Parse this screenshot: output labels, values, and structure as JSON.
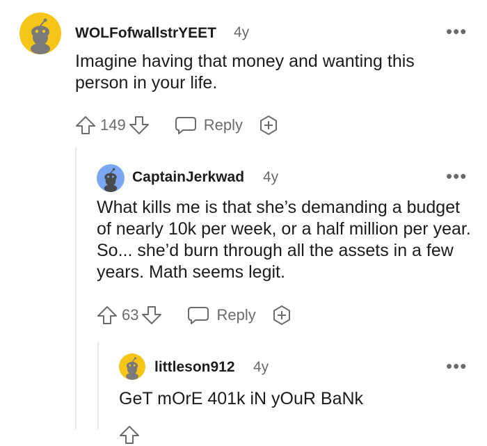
{
  "comments": [
    {
      "username": "WOLFofwallstrYEET",
      "age": "4y",
      "avatar_color": "#f5c518",
      "body": "Imagine having that money and wanting this person in your life.",
      "score": "149",
      "reply_label": "Reply"
    },
    {
      "username": "CaptainJerkwad",
      "age": "4y",
      "avatar_color": "#7ba7f2",
      "body": "What kills me is that she’s demanding a budget of nearly 10k per week, or a half million per year. So... she’d burn through all the assets in a few years. Math seems legit.",
      "score": "63",
      "reply_label": "Reply"
    },
    {
      "username": "littleson912",
      "age": "4y",
      "avatar_color": "#f5c518",
      "body": "GeT mOrE 401k iN yOuR BaNk"
    }
  ],
  "menu_glyph": "•••"
}
